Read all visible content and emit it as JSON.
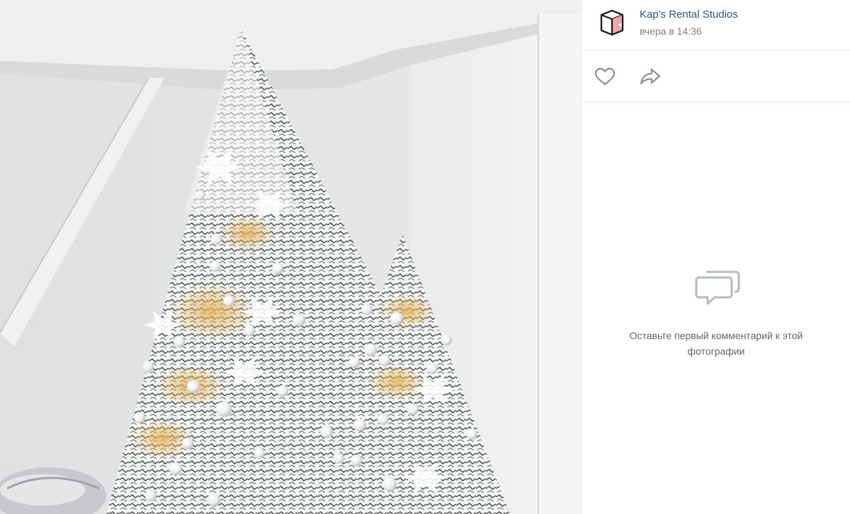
{
  "photo": {
    "alt_name": "christmas-trees-photo"
  },
  "author": {
    "name": "Kap's Rental Studios",
    "time": "вчера в 14:36",
    "avatar_icon": "kap-logo-icon",
    "name_color": "#2a5885"
  },
  "actions": {
    "like_icon": "heart-icon",
    "share_icon": "share-arrow-icon"
  },
  "comments": {
    "empty_icon": "comment-bubbles-icon",
    "empty_text": "Оставьте первый комментарий к этой фотографии"
  }
}
